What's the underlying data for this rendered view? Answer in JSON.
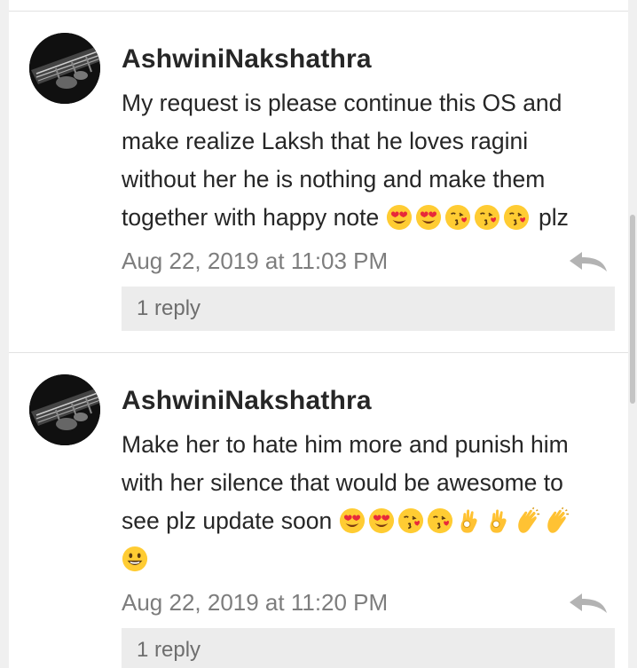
{
  "comments": [
    {
      "author": "AshwiniNakshathra",
      "lines": [
        "My request is please continue this OS and",
        "make realize Laksh that he loves ragini",
        "without her he is nothing and make them",
        "together with happy note"
      ],
      "trailing_text": "plz",
      "timestamp": "Aug 22, 2019 at 11:03 PM",
      "reply_label": "1 reply"
    },
    {
      "author": "AshwiniNakshathra",
      "lines": [
        "Make her to hate him more and punish him",
        "with her silence that would be awesome to",
        "see plz update soon"
      ],
      "timestamp": "Aug 22, 2019 at 11:20 PM",
      "reply_label": "1 reply"
    }
  ],
  "emoji_sets": {
    "comment_1": [
      "heart-eyes-emoji",
      "heart-eyes-emoji",
      "kissing-heart-emoji",
      "kissing-heart-emoji",
      "kissing-heart-emoji"
    ],
    "comment_2": [
      "heart-eyes-emoji",
      "heart-eyes-emoji",
      "kissing-heart-emoji",
      "kissing-heart-emoji",
      "ok-hand-emoji",
      "ok-hand-emoji",
      "clapping-hands-emoji",
      "clapping-hands-emoji",
      "smiley-emoji"
    ]
  },
  "colors": {
    "text": "#262626",
    "meta": "#7d7d7d",
    "reply_bg": "#ececec",
    "divider": "#e2e2e2"
  }
}
